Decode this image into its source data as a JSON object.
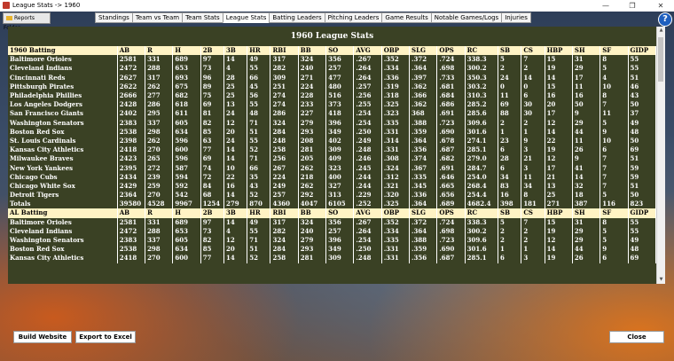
{
  "window": {
    "title": "League Stats -> 1960",
    "min": "—",
    "restore": "❐",
    "close": "✕"
  },
  "reports_folder": {
    "label": "Reports Folder"
  },
  "tabs": [
    "Standings",
    "Team vs Team",
    "Team Stats",
    "League Stats",
    "Batting Leaders",
    "Pitching Leaders",
    "Game Results",
    "Notable Games/Logs",
    "Injuries"
  ],
  "active_tab": 3,
  "help": {
    "label": "?"
  },
  "panel": {
    "title": "1960 League Stats"
  },
  "columns": [
    "AB",
    "R",
    "H",
    "2B",
    "3B",
    "HR",
    "RBI",
    "BB",
    "SO",
    "AVG",
    "OBP",
    "SLG",
    "OPS",
    "RC",
    "SB",
    "CS",
    "HBP",
    "SH",
    "SF",
    "GIDP"
  ],
  "sections": [
    {
      "header": "1960 Batting",
      "rows": [
        [
          "Baltimore Orioles",
          "2581",
          "331",
          "689",
          "97",
          "14",
          "49",
          "317",
          "324",
          "356",
          ".267",
          ".352",
          ".372",
          ".724",
          "338.3",
          "5",
          "7",
          "15",
          "31",
          "8",
          "55"
        ],
        [
          "Cleveland Indians",
          "2472",
          "288",
          "653",
          "73",
          "4",
          "55",
          "282",
          "240",
          "257",
          ".264",
          ".334",
          ".364",
          ".698",
          "300.2",
          "2",
          "2",
          "19",
          "29",
          "5",
          "55"
        ],
        [
          "Cincinnati Reds",
          "2627",
          "317",
          "693",
          "96",
          "28",
          "66",
          "309",
          "271",
          "477",
          ".264",
          ".336",
          ".397",
          ".733",
          "350.3",
          "24",
          "14",
          "14",
          "17",
          "4",
          "51"
        ],
        [
          "Pittsburgh Pirates",
          "2622",
          "262",
          "675",
          "89",
          "25",
          "45",
          "251",
          "224",
          "480",
          ".257",
          ".319",
          ".362",
          ".681",
          "303.2",
          "0",
          "0",
          "15",
          "11",
          "10",
          "46"
        ],
        [
          "Philadelphia Phillies",
          "2666",
          "277",
          "682",
          "75",
          "25",
          "56",
          "274",
          "228",
          "516",
          ".256",
          ".318",
          ".366",
          ".684",
          "310.3",
          "11",
          "6",
          "16",
          "16",
          "8",
          "43"
        ],
        [
          "Los Angeles Dodgers",
          "2428",
          "286",
          "618",
          "69",
          "13",
          "55",
          "274",
          "233",
          "373",
          ".255",
          ".325",
          ".362",
          ".686",
          "285.2",
          "69",
          "30",
          "20",
          "50",
          "7",
          "50"
        ],
        [
          "San Francisco Giants",
          "2402",
          "295",
          "611",
          "81",
          "24",
          "48",
          "286",
          "227",
          "418",
          ".254",
          ".323",
          "368",
          ".691",
          "285.6",
          "88",
          "30",
          "17",
          "9",
          "11",
          "37"
        ],
        [
          "Washington Senators",
          "2383",
          "337",
          "605",
          "82",
          "12",
          "71",
          "324",
          "279",
          "396",
          ".254",
          ".335",
          ".388",
          ".723",
          "309.6",
          "2",
          "2",
          "12",
          "29",
          "5",
          "49"
        ],
        [
          "Boston Red Sox",
          "2538",
          "298",
          "634",
          "85",
          "20",
          "51",
          "284",
          "293",
          "349",
          ".250",
          ".331",
          ".359",
          ".690",
          "301.6",
          "1",
          "1",
          "14",
          "44",
          "9",
          "48"
        ],
        [
          "St. Louis Cardinals",
          "2398",
          "262",
          "596",
          "63",
          "24",
          "55",
          "248",
          "208",
          "402",
          ".249",
          ".314",
          ".364",
          ".678",
          "274.1",
          "23",
          "9",
          "22",
          "11",
          "10",
          "50"
        ],
        [
          "Kansas City Athletics",
          "2418",
          "270",
          "600",
          "77",
          "14",
          "52",
          "258",
          "281",
          "309",
          ".248",
          ".331",
          ".356",
          ".687",
          "285.1",
          "6",
          "3",
          "19",
          "26",
          "6",
          "69"
        ],
        [
          "Milwaukee Braves",
          "2423",
          "265",
          "596",
          "69",
          "14",
          "71",
          "256",
          "205",
          "409",
          ".246",
          ".308",
          ".374",
          ".682",
          "279.0",
          "28",
          "21",
          "12",
          "9",
          "7",
          "51"
        ],
        [
          "New York Yankees",
          "2395",
          "272",
          "587",
          "74",
          "10",
          "66",
          "267",
          "262",
          "323",
          ".245",
          ".324",
          ".367",
          ".691",
          "284.7",
          "6",
          "3",
          "17",
          "41",
          "7",
          "59"
        ],
        [
          "Chicago Cubs",
          "2434",
          "239",
          "594",
          "72",
          "22",
          "35",
          "224",
          "218",
          "400",
          ".244",
          ".312",
          ".335",
          ".646",
          "254.0",
          "34",
          "11",
          "21",
          "14",
          "7",
          "59"
        ],
        [
          "Chicago White Sox",
          "2429",
          "259",
          "592",
          "84",
          "16",
          "43",
          "249",
          "262",
          "327",
          ".244",
          ".321",
          ".345",
          ".665",
          "268.4",
          "83",
          "34",
          "13",
          "32",
          "7",
          "51"
        ],
        [
          "Detroit Tigers",
          "2364",
          "270",
          "542",
          "68",
          "14",
          "52",
          "257",
          "292",
          "313",
          ".229",
          ".320",
          ".336",
          ".656",
          "254.4",
          "16",
          "8",
          "25",
          "18",
          "5",
          "50"
        ]
      ],
      "total": [
        "Totals",
        "39580",
        "4528",
        "9967",
        "1254",
        "279",
        "870",
        "4360",
        "4047",
        "6105",
        ".252",
        ".325",
        ".364",
        ".689",
        "4682.4",
        "398",
        "181",
        "271",
        "387",
        "116",
        "823"
      ]
    },
    {
      "header": "AL Batting",
      "rows": [
        [
          "Baltimore Orioles",
          "2581",
          "331",
          "689",
          "97",
          "14",
          "49",
          "317",
          "324",
          "356",
          ".267",
          ".352",
          ".372",
          ".724",
          "338.3",
          "5",
          "7",
          "15",
          "31",
          "8",
          "55"
        ],
        [
          "Cleveland Indians",
          "2472",
          "288",
          "653",
          "73",
          "4",
          "55",
          "282",
          "240",
          "257",
          ".264",
          ".334",
          ".364",
          ".698",
          "300.2",
          "2",
          "2",
          "19",
          "29",
          "5",
          "55"
        ],
        [
          "Washington Senators",
          "2383",
          "337",
          "605",
          "82",
          "12",
          "71",
          "324",
          "279",
          "396",
          ".254",
          ".335",
          ".388",
          ".723",
          "309.6",
          "2",
          "2",
          "12",
          "29",
          "5",
          "49"
        ],
        [
          "Boston Red Sox",
          "2538",
          "298",
          "634",
          "85",
          "20",
          "51",
          "284",
          "293",
          "349",
          ".250",
          ".331",
          ".359",
          ".690",
          "301.6",
          "1",
          "1",
          "14",
          "44",
          "9",
          "48"
        ],
        [
          "Kansas City Athletics",
          "2418",
          "270",
          "600",
          "77",
          "14",
          "52",
          "258",
          "281",
          "309",
          ".248",
          ".331",
          ".356",
          ".687",
          "285.1",
          "6",
          "3",
          "19",
          "26",
          "6",
          "69"
        ]
      ]
    }
  ],
  "buttons": {
    "build": "Build Website",
    "export": "Export to Excel",
    "close": "Close"
  }
}
